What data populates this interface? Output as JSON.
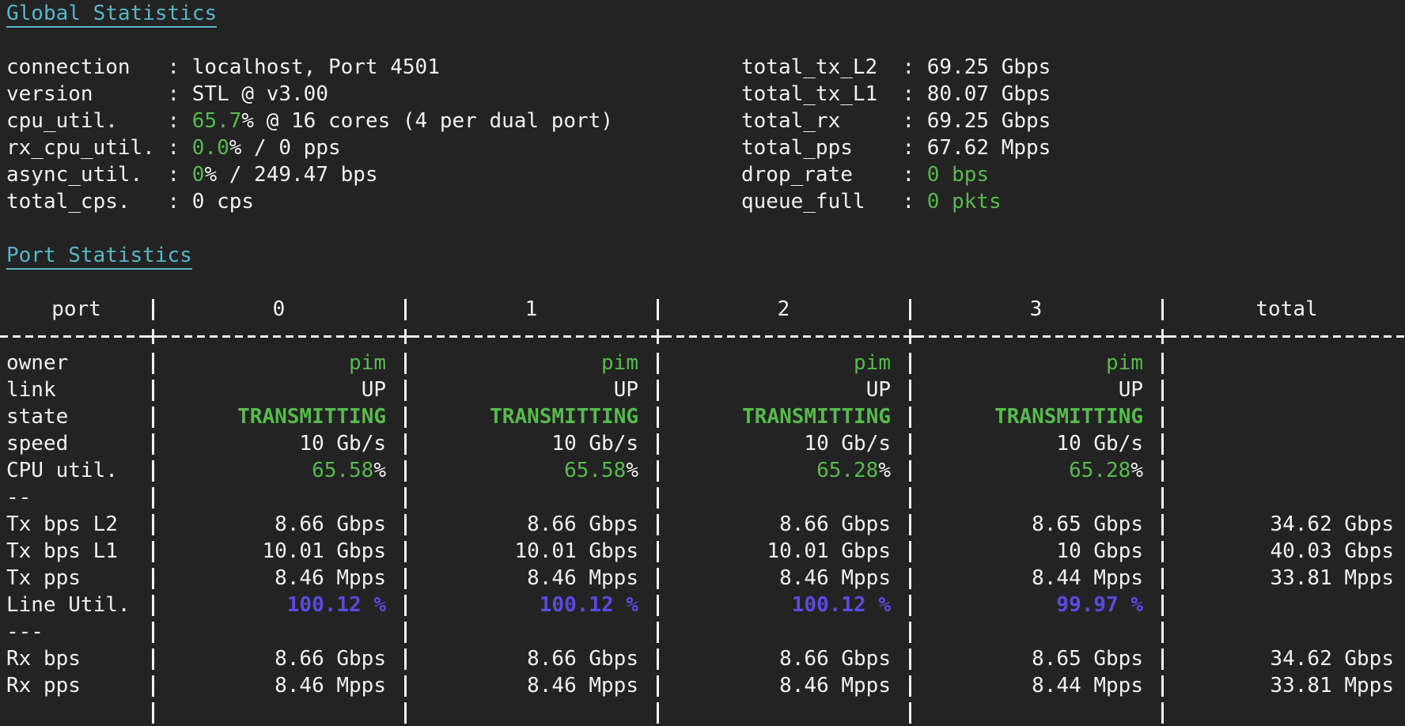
{
  "colors": {
    "background": "#232323",
    "foreground": "#f1f1f1",
    "heading_teal": "#57b6c7",
    "ok_green": "#56bb4c",
    "line_util_purple": "#5b4be1"
  },
  "chars": {
    "colon": ":"
  },
  "global_statistics": {
    "title": "Global Statistics",
    "left": [
      {
        "label": "connection",
        "highlight": "",
        "rest": "localhost, Port 4501"
      },
      {
        "label": "version",
        "highlight": "",
        "rest": "STL @ v3.00"
      },
      {
        "label": "cpu_util.",
        "highlight": "65.7",
        "rest": "% @ 16 cores (4 per dual port)"
      },
      {
        "label": "rx_cpu_util.",
        "highlight": "0.0",
        "rest": "% / 0 pps"
      },
      {
        "label": "async_util.",
        "highlight": "0",
        "rest": "% / 249.47 bps"
      },
      {
        "label": "total_cps.",
        "highlight": "",
        "rest": "0 cps"
      }
    ],
    "right": [
      {
        "label": "total_tx_L2",
        "highlight": "",
        "rest": "69.25 Gbps"
      },
      {
        "label": "total_tx_L1",
        "highlight": "",
        "rest": "80.07 Gbps"
      },
      {
        "label": "total_rx",
        "highlight": "",
        "rest": "69.25 Gbps"
      },
      {
        "label": "total_pps",
        "highlight": "",
        "rest": "67.62 Mpps"
      },
      {
        "label": "drop_rate",
        "highlight": "0 bps",
        "rest": ""
      },
      {
        "label": "queue_full",
        "highlight": "0 pkts",
        "rest": ""
      }
    ]
  },
  "port_statistics": {
    "title": "Port Statistics",
    "header": {
      "label": "port",
      "col0": "0",
      "col1": "1",
      "col2": "2",
      "col3": "3",
      "total": "total"
    },
    "rows": {
      "owner": {
        "label": "owner",
        "values": [
          "pim",
          "pim",
          "pim",
          "pim"
        ],
        "total": ""
      },
      "link": {
        "label": "link",
        "values": [
          "UP",
          "UP",
          "UP",
          "UP"
        ],
        "total": ""
      },
      "state": {
        "label": "state",
        "values": [
          "TRANSMITTING",
          "TRANSMITTING",
          "TRANSMITTING",
          "TRANSMITTING"
        ],
        "total": ""
      },
      "speed": {
        "label": "speed",
        "values": [
          "10 Gb/s",
          "10 Gb/s",
          "10 Gb/s",
          "10 Gb/s"
        ],
        "total": ""
      },
      "cpu": {
        "label": "CPU util.",
        "nums": [
          "65.58",
          "65.58",
          "65.28",
          "65.28"
        ],
        "suffix": "%",
        "total": ""
      },
      "sep1": {
        "label": "--"
      },
      "tx_bps_l2": {
        "label": "Tx bps L2",
        "values": [
          "8.66 Gbps",
          "8.66 Gbps",
          "8.66 Gbps",
          "8.65 Gbps"
        ],
        "total": "34.62 Gbps"
      },
      "tx_bps_l1": {
        "label": "Tx bps L1",
        "values": [
          "10.01 Gbps",
          "10.01 Gbps",
          "10.01 Gbps",
          "10 Gbps"
        ],
        "total": "40.03 Gbps"
      },
      "tx_pps": {
        "label": "Tx pps",
        "values": [
          "8.46 Mpps",
          "8.46 Mpps",
          "8.46 Mpps",
          "8.44 Mpps"
        ],
        "total": "33.81 Mpps"
      },
      "line_util": {
        "label": "Line Util.",
        "values": [
          "100.12 %",
          "100.12 %",
          "100.12 %",
          "99.97 %"
        ],
        "total": ""
      },
      "sep2": {
        "label": "---"
      },
      "rx_bps": {
        "label": "Rx bps",
        "values": [
          "8.66 Gbps",
          "8.66 Gbps",
          "8.66 Gbps",
          "8.65 Gbps"
        ],
        "total": "34.62 Gbps"
      },
      "rx_pps": {
        "label": "Rx pps",
        "values": [
          "8.46 Mpps",
          "8.46 Mpps",
          "8.46 Mpps",
          "8.44 Mpps"
        ],
        "total": "33.81 Mpps"
      },
      "partial": {
        "label": ""
      }
    }
  }
}
